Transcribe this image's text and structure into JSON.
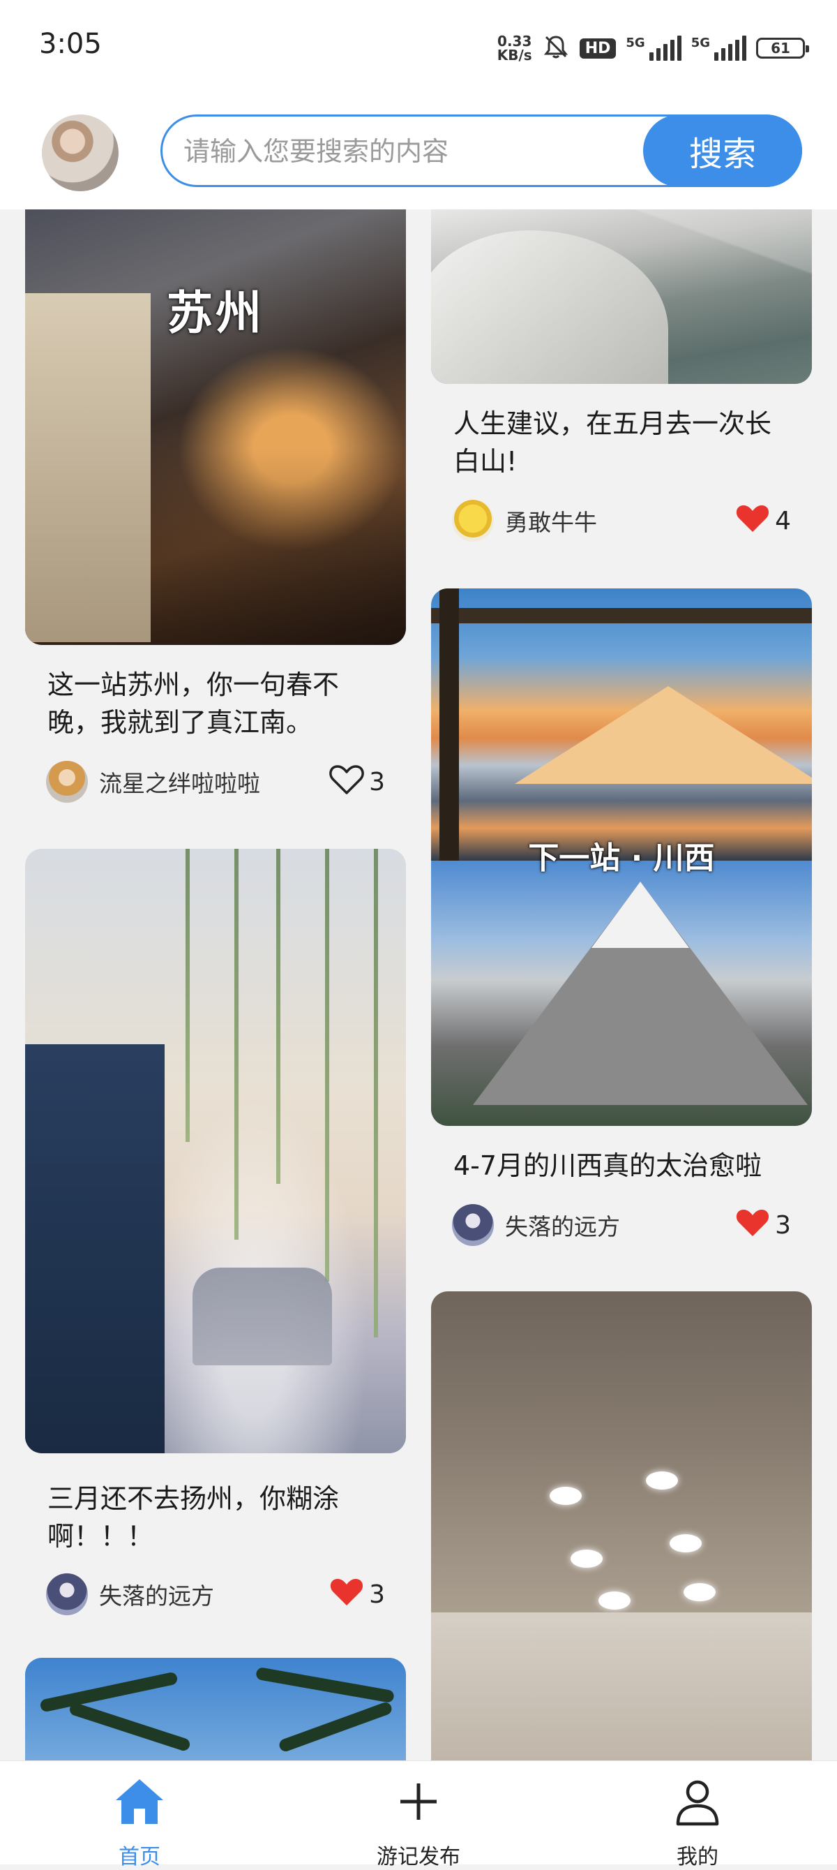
{
  "status_bar": {
    "time": "3:05",
    "net_speed_value": "0.33",
    "net_speed_unit": "KB/s",
    "hd_label": "HD",
    "signal_1_label": "5G",
    "signal_2_label": "5G",
    "battery": "61"
  },
  "search": {
    "placeholder": "请输入您要搜索的内容",
    "value": "",
    "button_label": "搜索"
  },
  "feed": {
    "cards": [
      {
        "image_caption": "苏州",
        "title": "这一站苏州，你一句春不晚，我就到了真江南。",
        "author": "流星之绊啦啦啦",
        "likes": "3",
        "liked": false
      },
      {
        "title": "人生建议，在五月去一次长白山!",
        "author": "勇敢牛牛",
        "likes": "4",
        "liked": true
      },
      {
        "image_caption": "下一站 · 川西",
        "title": "4-7月的川西真的太治愈啦",
        "author": "失落的远方",
        "likes": "3",
        "liked": true
      },
      {
        "title": "三月还不去扬州，你糊涂啊！！！",
        "author": "失落的远方",
        "likes": "3",
        "liked": true
      }
    ]
  },
  "bottom_nav": {
    "home": "首页",
    "publish": "游记发布",
    "mine": "我的"
  },
  "colors": {
    "accent": "#3d8ee8",
    "like_red": "#e8342c"
  },
  "icons": {
    "home": "home-icon",
    "publish": "plus-icon",
    "mine": "person-icon",
    "like": "heart-icon"
  }
}
